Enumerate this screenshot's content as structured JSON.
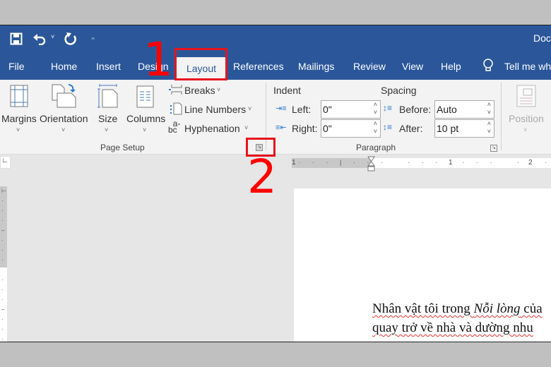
{
  "titlebar": {
    "title": "Doc",
    "icons": [
      "save-icon",
      "undo-icon",
      "undo-dropdown-icon",
      "redo-icon",
      "customize-icon"
    ]
  },
  "tabs": [
    {
      "label": "File"
    },
    {
      "label": "Home"
    },
    {
      "label": "Insert"
    },
    {
      "label": "Design"
    },
    {
      "label": "Layout",
      "active": true
    },
    {
      "label": "References"
    },
    {
      "label": "Mailings"
    },
    {
      "label": "Review"
    },
    {
      "label": "View"
    },
    {
      "label": "Help"
    }
  ],
  "tell_me": "Tell me wh",
  "page_setup": {
    "margins": "Margins",
    "orientation": "Orientation",
    "size": "Size",
    "columns": "Columns",
    "breaks": "Breaks",
    "line_numbers": "Line Numbers",
    "hyphenation": "Hyphenation",
    "group": "Page Setup"
  },
  "paragraph": {
    "indent": "Indent",
    "left_label": "Left:",
    "left_value": "0\"",
    "right_label": "Right:",
    "right_value": "0\"",
    "spacing": "Spacing",
    "before_label": "Before:",
    "before_value": "Auto",
    "after_label": "After:",
    "after_value": "10 pt",
    "group": "Paragraph"
  },
  "arrange": {
    "position": "Position"
  },
  "annotations": {
    "step1": "1",
    "step2": "2",
    "color": "#e8141c"
  },
  "ruler": {
    "labels": [
      "1",
      "1",
      "2"
    ]
  },
  "document": {
    "line1_a": "Nhân vật tôi trong ",
    "line1_italic": "Nỗi lòng",
    "line1_b": " của",
    "line2": "quay trở về nhà và dường nhu"
  },
  "colors": {
    "accent": "#2b579a",
    "ribbon": "#f3f3f3"
  }
}
